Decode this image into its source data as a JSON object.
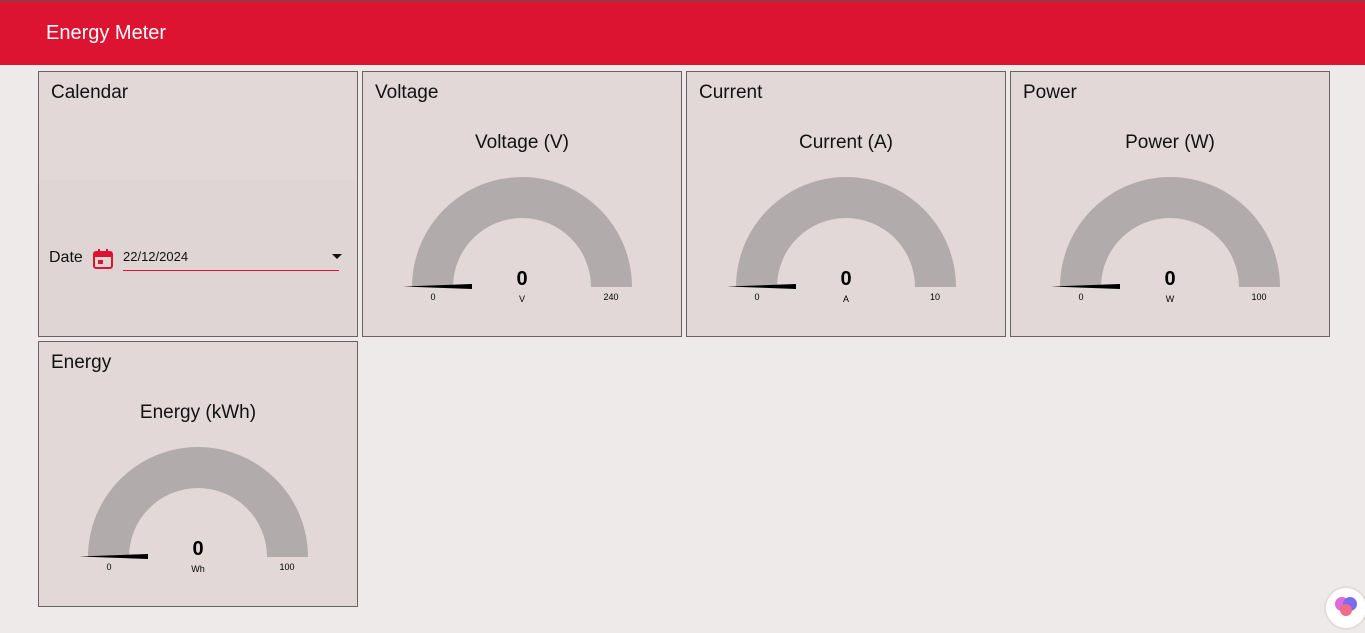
{
  "header": {
    "title": "Energy Meter",
    "accent": "#dc1431"
  },
  "calendar": {
    "title": "Calendar",
    "date_label": "Date",
    "date_value": "22/12/2024",
    "icon": "calendar-icon"
  },
  "gauges": [
    {
      "id": "voltage",
      "title": "Voltage",
      "gauge_title": "Voltage (V)",
      "value": "0",
      "unit": "V",
      "min": "0",
      "max": "240"
    },
    {
      "id": "current",
      "title": "Current",
      "gauge_title": "Current (A)",
      "value": "0",
      "unit": "A",
      "min": "0",
      "max": "10"
    },
    {
      "id": "power",
      "title": "Power",
      "gauge_title": "Power (W)",
      "value": "0",
      "unit": "W",
      "min": "0",
      "max": "100"
    },
    {
      "id": "energy",
      "title": "Energy",
      "gauge_title": "Energy (kWh)",
      "value": "0",
      "unit": "Wh",
      "min": "0",
      "max": "100"
    }
  ],
  "colors": {
    "gauge_arc": "#b1abab",
    "needle": "#000000"
  },
  "floating_button": {
    "icon": "brain-icon"
  }
}
